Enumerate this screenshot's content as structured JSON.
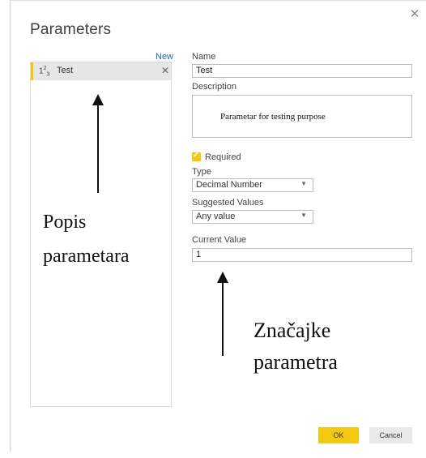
{
  "dialog": {
    "title": "Parameters",
    "close_icon": "close-icon",
    "new_label": "New",
    "ok_label": "OK",
    "cancel_label": "Cancel"
  },
  "parameter_list": {
    "items": [
      {
        "type_icon": "number-type-icon",
        "type_main": "1",
        "type_sup": "2",
        "type_sub": "3",
        "label": "Test",
        "delete_icon": "delete-icon"
      }
    ]
  },
  "form": {
    "name_label": "Name",
    "name_value": "Test",
    "description_label": "Description",
    "description_value": "Parametar for testing purpose",
    "required_label": "Required",
    "required_checked": true,
    "type_label": "Type",
    "type_value": "Decimal Number",
    "suggested_label": "Suggested Values",
    "suggested_value": "Any value",
    "current_label": "Current Value",
    "current_value": "1"
  },
  "annotations": {
    "list_line1": "Popis",
    "list_line2": "parametara",
    "props_line1": "Značajke",
    "props_line2": "parametra"
  },
  "colors": {
    "accent": "#f2c811",
    "link": "#2b63c6"
  }
}
